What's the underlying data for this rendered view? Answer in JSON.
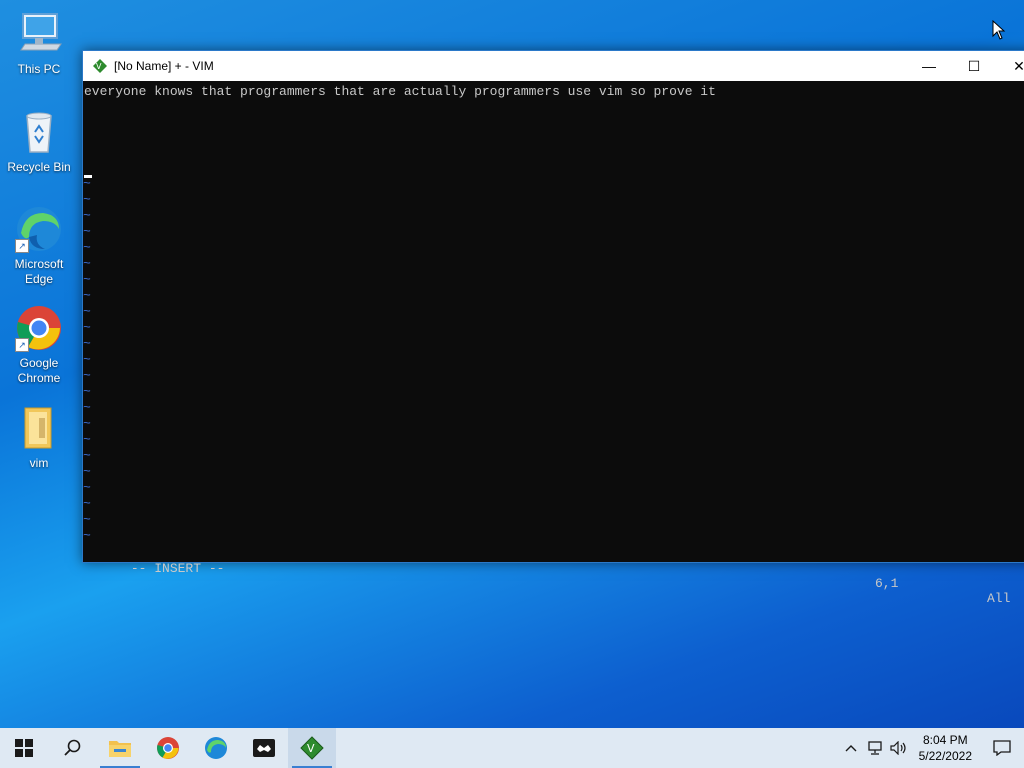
{
  "desktop": {
    "icons": [
      {
        "label": "This PC",
        "icon": "this-pc-icon"
      },
      {
        "label": "Recycle Bin",
        "icon": "recycle-bin-icon"
      },
      {
        "label": "Microsoft Edge",
        "icon": "edge-icon"
      },
      {
        "label": "Google Chrome",
        "icon": "chrome-icon"
      },
      {
        "label": "vim",
        "icon": "folder-icon"
      }
    ]
  },
  "window": {
    "title": "[No Name] + - VIM",
    "minimize": "—",
    "maximize": "☐",
    "close": "✕"
  },
  "editor": {
    "lines": [
      "everyone knows that programmers that are actually programmers use vim so prove it"
    ],
    "tilde": "~",
    "mode": "-- INSERT --",
    "position": "6,1",
    "scroll": "All"
  },
  "taskbar": {
    "apps": [
      "start-icon",
      "search-icon",
      "file-explorer-icon",
      "chrome-icon",
      "edge-icon",
      "game-icon",
      "vim-icon"
    ],
    "time": "8:04 PM",
    "date": "5/22/2022"
  },
  "colors": {
    "desktop_blue": "#0a74d8",
    "terminal_bg": "#0c0c0c",
    "tilde_blue": "#3c6fd6",
    "taskbar_bg": "#dfe9f3"
  }
}
